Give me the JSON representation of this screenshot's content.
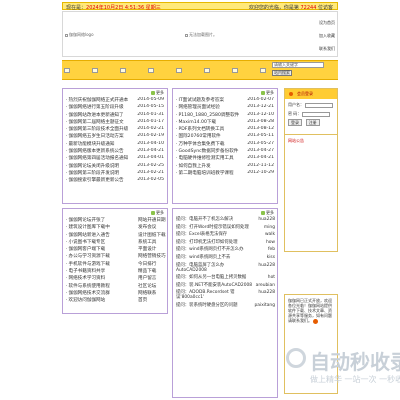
{
  "topbar": {
    "date_label": "现在是：",
    "date_value": "2024年10月2日 4:51:36 星期三",
    "welcome": "欢迎您的光临，你是第",
    "visitor_count": "72244",
    "welcome_suffix": "位访客"
  },
  "header": {
    "logo_alt": "伽伽网络logo",
    "banner_alt": "无法加载图片。",
    "links": [
      "设为首页",
      "加入收藏",
      "联系我们"
    ]
  },
  "search": {
    "placeholder": "请输入关键字",
    "button": "站内搜索"
  },
  "login": {
    "title": "会员登录",
    "user_label": "用户名：",
    "pass_label": "密  码：",
    "login_btn": "登录",
    "reg_btn": "注册",
    "notice_title": "网站公告"
  },
  "more_label": "更多",
  "news_left": [
    {
      "title": "热烈庆祝伽伽网络正式开通本",
      "date": "2014-05-09"
    },
    {
      "title": "伽伽网络进行第五阶段升级",
      "date": "2014-05-15"
    },
    {
      "title": "伽伽网站改进本更新通知了",
      "date": "2014-01-31"
    },
    {
      "title": "伽伽网第二届网络主题征文",
      "date": "2014-01-17"
    },
    {
      "title": "伽伽网第三阶段技术全面升级",
      "date": "2014-02-21"
    },
    {
      "title": "伽伽网络五岁生日活动方案",
      "date": "2014-02-19"
    },
    {
      "title": "最新功能模块升级通知",
      "date": "2013-04-10"
    },
    {
      "title": "伽伽网络版本更新系统公告",
      "date": "2013-04-21"
    },
    {
      "title": "伽伽网络第四届活动报名通知",
      "date": "2013-04-01"
    },
    {
      "title": "伽伽网论坛关闭升级说明",
      "date": "2013-02-25"
    },
    {
      "title": "伽伽网第三阶段开发说明",
      "date": "2013-02-21"
    },
    {
      "title": "伽伽搜索引擎最新更新公告",
      "date": "2013-02-05"
    }
  ],
  "news_mid": [
    {
      "title": "IT面试试题及参考答案",
      "date": "2014-02-07"
    },
    {
      "title": "网络管理员面试经验",
      "date": "2013-12-21"
    },
    {
      "title": "P1180_1880_2580调整软件",
      "date": "2013-12-10"
    },
    {
      "title": "Maxim14.00下载",
      "date": "2013-08-28"
    },
    {
      "title": "PDF系列文档转换工具",
      "date": "2013-08-12"
    },
    {
      "title": "国际20760常用软件",
      "date": "2013-05-11"
    },
    {
      "title": "万种字体合集免费下载",
      "date": "2013-05-27"
    },
    {
      "title": "GoodSync数据同步备份软件",
      "date": "2013-04-27"
    },
    {
      "title": "电脑硬件维修检测实用工具",
      "date": "2013-04-21"
    },
    {
      "title": "如何自我上升发",
      "date": "2012-11-12"
    },
    {
      "title": "第二期电脑培训班教学课程",
      "date": "2012-10-29"
    }
  ],
  "pairs_left": [
    {
      "a": "伽伽网论坛开张了",
      "b": "网站开通日期"
    },
    {
      "a": "建筑设计图库下载中",
      "b": "发布会议"
    },
    {
      "a": "伽伽网站新进入通告",
      "b": "设计图纸下载"
    },
    {
      "a": "小说图书下载专区",
      "b": "系统工具"
    },
    {
      "a": "伽伽网客户端下载",
      "b": "平面设计"
    },
    {
      "a": "办公与学习资源下载",
      "b": "网络营销技巧"
    },
    {
      "a": "手机软件与游戏下载",
      "b": "今日排行"
    },
    {
      "a": "电子书籍资料共享",
      "b": "精品下载"
    },
    {
      "a": "网络技术学习资料",
      "b": "用户留言"
    },
    {
      "a": "软件与系统使用教程",
      "b": "社区论坛"
    },
    {
      "a": "伽伽网络技术交流群",
      "b": "网络联系"
    },
    {
      "a": "欢迎访问伽伽网站",
      "b": "首页"
    }
  ],
  "qa_mid": [
    {
      "q": "提问：电脑开不了机怎么解决",
      "u": "hua228"
    },
    {
      "q": "提问：打开Word时提示错误如何处理",
      "u": "ming"
    },
    {
      "q": "提问：Excel表格无法保存",
      "u": "walk"
    },
    {
      "q": "提问：打印机无法打印如何处理",
      "u": "how"
    },
    {
      "q": "提问：wind系统网页打不开怎么办",
      "u": "feb"
    },
    {
      "q": "提问：wind系统网页上不去",
      "u": "kiss"
    },
    {
      "q": "提问：电脑蓝屏了怎么办 AutoCAD2008",
      "u": "hua228"
    },
    {
      "q": "提问：如何从另一台电脑上拷贝数据",
      "u": "hot"
    },
    {
      "q": "提问：装.NET不能安装AutoCAD2008",
      "u": "areubian"
    },
    {
      "q": "提问：ADODB.Recordset 错误'800a0cc1'",
      "u": "hua228"
    },
    {
      "q": "提问：装系统时硬盘分区的问题",
      "u": "paixitang"
    }
  ],
  "rightnote": {
    "text": "伽伽网已正式开放，欢迎各位光临！伽伽网站提供软件下载、技术文章、资源共享等服务，如有问题请联系我们。"
  },
  "watermark": {
    "title": "自动秒收录",
    "subtitle": "做上精华 一站一次 一秒收录一"
  }
}
